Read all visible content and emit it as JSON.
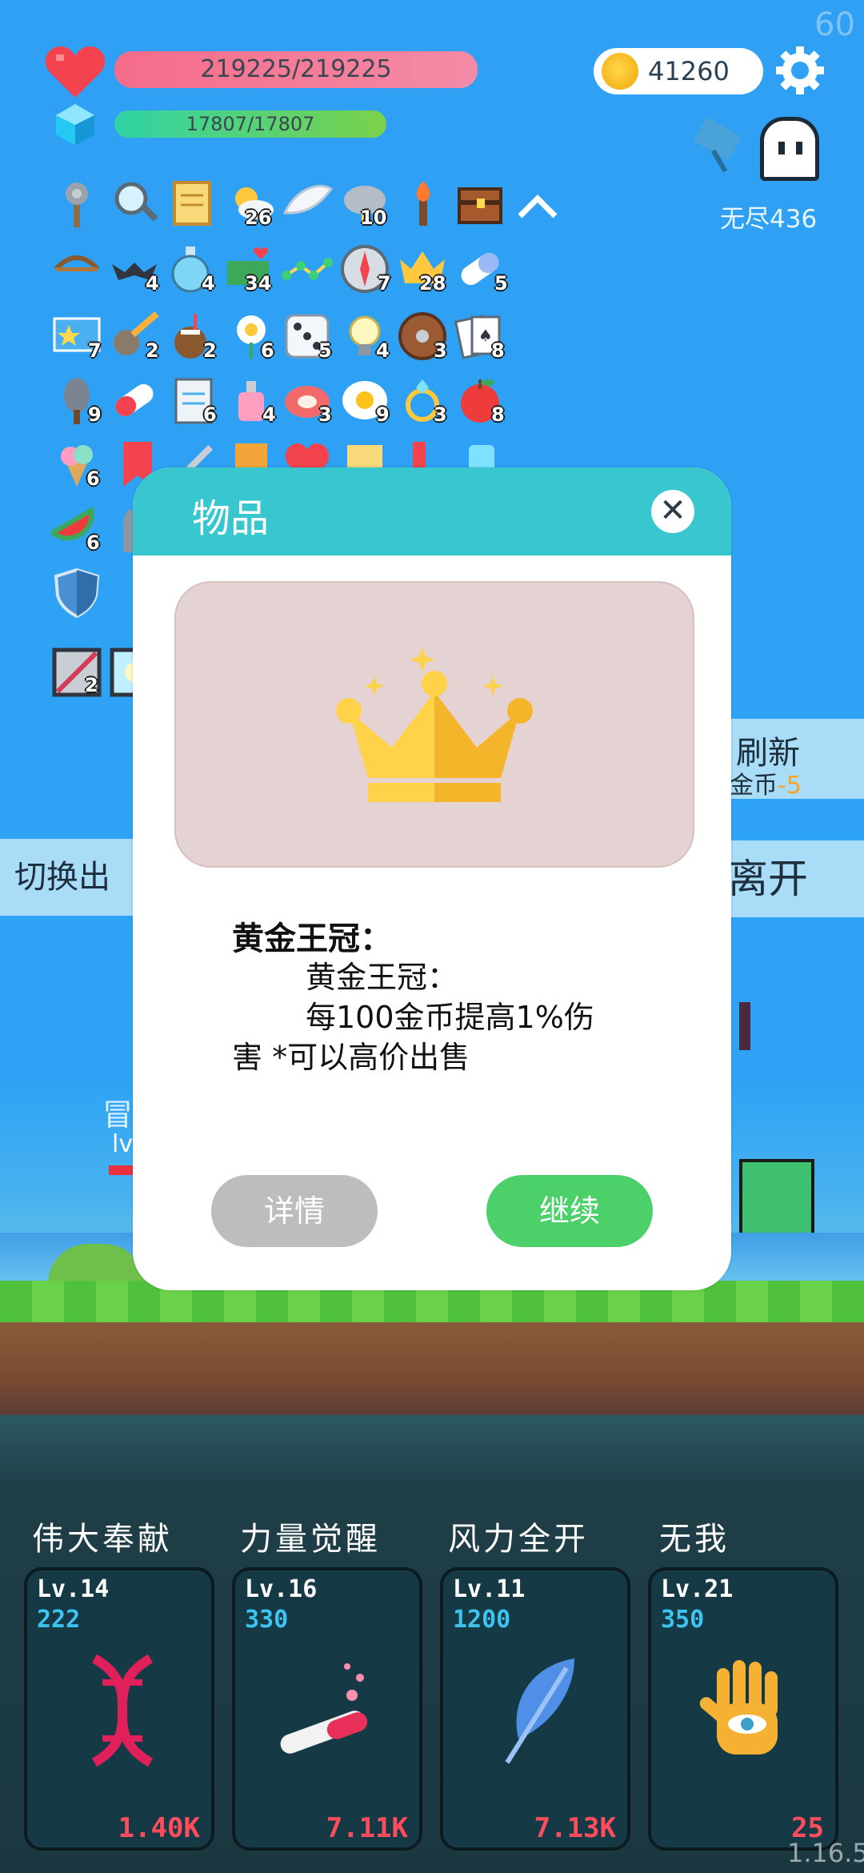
{
  "hud": {
    "fps": "60",
    "hp": "219225/219225",
    "mp": "17807/17807",
    "gold": "41260",
    "endless": "无尽436"
  },
  "inventory": {
    "counts": [
      "26",
      "10",
      "4",
      "4",
      "34",
      "7",
      "28",
      "5",
      "7",
      "2",
      "2",
      "6",
      "5",
      "4",
      "3",
      "8",
      "9",
      "6",
      "4",
      "3",
      "9",
      "3",
      "8",
      "6",
      "6",
      "2"
    ]
  },
  "side": {
    "refresh": "刷新",
    "refresh_cost_label": "金币",
    "refresh_cost": "-5",
    "leave": "离开",
    "switch": "切换出"
  },
  "background": {
    "hero_label": "冒",
    "hero_level": "lv"
  },
  "dialog": {
    "title": "物品",
    "close": "✕",
    "item_name": "黄金王冠：",
    "desc_line1": "黄金王冠：",
    "desc_line2": "每100金币提高1%伤",
    "desc_line3": "害 *可以高价出售",
    "detail_button": "详情",
    "continue_button": "继续"
  },
  "skills": [
    {
      "name": "伟大奉献",
      "level": "Lv.14",
      "cost": "222",
      "value": "1.40K",
      "icon": "dna-icon"
    },
    {
      "name": "力量觉醒",
      "level": "Lv.16",
      "cost": "330",
      "value": "7.11K",
      "icon": "potion-tube-icon"
    },
    {
      "name": "风力全开",
      "level": "Lv.11",
      "cost": "1200",
      "value": "7.13K",
      "icon": "feather-icon"
    },
    {
      "name": "无我",
      "level": "Lv.21",
      "cost": "350",
      "value": "25",
      "icon": "hand-eye-icon"
    }
  ],
  "version": "1.16.5",
  "colors": {
    "hp": "#f56c8a",
    "mp": "#2fd3a5",
    "dialog_header": "#38c6cf",
    "continue": "#4cd06a",
    "detail": "#bdbdbd",
    "skill_value": "#ff4d5d",
    "skill_cost": "#3cc3f0"
  }
}
